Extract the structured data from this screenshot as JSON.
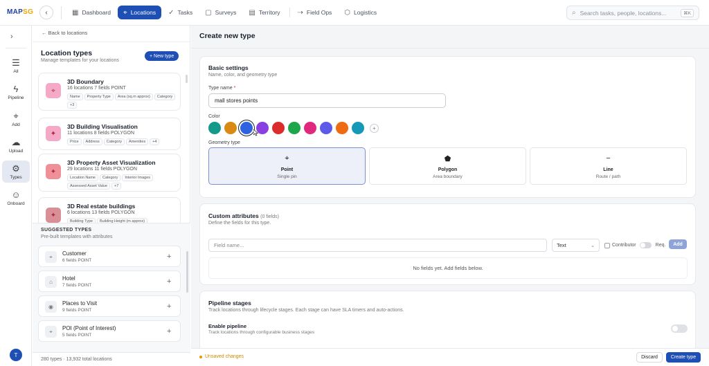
{
  "brand": {
    "logo_main": "MAP",
    "logo_accent": "SG"
  },
  "nav": {
    "tabs": [
      {
        "label": "Dashboard",
        "icon": "grid-icon"
      },
      {
        "label": "Locations",
        "icon": "pin-icon",
        "active": true
      },
      {
        "label": "Tasks",
        "icon": "check-icon"
      },
      {
        "label": "Surveys",
        "icon": "clipboard-icon"
      },
      {
        "label": "Territory",
        "icon": "map-icon"
      },
      {
        "label": "Field Ops",
        "icon": "route-icon"
      },
      {
        "label": "Logistics",
        "icon": "box-icon"
      }
    ],
    "search_placeholder": "Search tasks, people, locations...",
    "search_shortcut": "⌘K"
  },
  "rail": {
    "items": [
      {
        "label": "All",
        "icon": "list-icon"
      },
      {
        "label": "Pipeline",
        "icon": "pipeline-icon"
      },
      {
        "label": "Add",
        "icon": "pin-icon"
      },
      {
        "label": "Upload",
        "icon": "upload-icon"
      },
      {
        "label": "Types",
        "icon": "gear-icon",
        "active": true
      },
      {
        "label": "Onboard",
        "icon": "user-add-icon"
      }
    ],
    "avatar_initial": "T"
  },
  "left_panel": {
    "back_label": "Back to locations",
    "title": "Location types",
    "subtitle": "Manage templates for your locations",
    "new_type_label": "+ New type",
    "types": [
      {
        "name": "3D Boundary",
        "meta": "16 locations  7 fields  POINT",
        "tags": [
          "Name",
          "Property Type",
          "Area (sq.m approx)",
          "Category",
          "+3"
        ],
        "icon_bg": "#f4a9c6"
      },
      {
        "name": "3D Building Visualisation",
        "meta": "11 locations  8 fields  POLYGON",
        "tags": [
          "Price",
          "Address",
          "Category",
          "Amenities",
          "+4"
        ],
        "icon_bg": "#f4a9c6"
      },
      {
        "name": "3D Property Asset Visualization",
        "meta": "29 locations  11 fields  POLYGON",
        "tags": [
          "Location Name",
          "Category",
          "Interior Images",
          "Assessed Asset Value",
          "+7"
        ],
        "icon_bg": "#ef8f97"
      },
      {
        "name": "3D Real estate buildings",
        "meta": "6 locations  13 fields  POLYGON",
        "tags": [
          "Building Type",
          "Building Height (m approx)"
        ],
        "icon_bg": "#d88f96"
      }
    ],
    "suggested_title": "SUGGESTED TYPES",
    "suggested_subtitle": "Pre-built templates with attributes",
    "suggested": [
      {
        "name": "Customer",
        "meta": "6 fields  POINT"
      },
      {
        "name": "Hotel",
        "meta": "7 fields  POINT"
      },
      {
        "name": "Places to Visit",
        "meta": "9 fields  POINT"
      },
      {
        "name": "POI (Point of Interest)",
        "meta": "5 fields  POINT"
      }
    ],
    "footer": "280 types · 13,932 total locations"
  },
  "main": {
    "title": "Create new type",
    "basic": {
      "title": "Basic settings",
      "subtitle": "Name, color, and geometry type",
      "type_name_label": "Type name",
      "type_name_value": "mall stores points",
      "color_label": "Color",
      "colors": [
        "#12998a",
        "#d98a12",
        "#2f62e0",
        "#8a3fe0",
        "#dc2b2b",
        "#1fa64a",
        "#e0297d",
        "#5d5ae8",
        "#ee6b13",
        "#1699b8"
      ],
      "selected_color": "#2f62e0",
      "geometry_label": "Geometry type",
      "geometry": [
        {
          "name": "Point",
          "sub": "Single pin",
          "icon": "pin-icon",
          "selected": true
        },
        {
          "name": "Polygon",
          "sub": "Area boundary",
          "icon": "pentagon-icon"
        },
        {
          "name": "Line",
          "sub": "Route / path",
          "icon": "line-icon"
        }
      ]
    },
    "attributes": {
      "title": "Custom attributes",
      "count": "(0 fields)",
      "subtitle": "Define the fields for this type.",
      "field_placeholder": "Field name...",
      "field_type": "Text",
      "contributor_label": "Contributor",
      "required_label": "Req.",
      "add_label": "Add",
      "empty_text": "No fields yet. Add fields below."
    },
    "pipeline": {
      "title": "Pipeline stages",
      "subtitle": "Track locations through lifecycle stages. Each stage can have SLA timers and auto-actions.",
      "enable_label": "Enable pipeline",
      "enable_sub": "Track locations through configurable business stages"
    }
  },
  "footer": {
    "unsaved": "Unsaved changes",
    "discard": "Discard",
    "create": "Create type"
  }
}
